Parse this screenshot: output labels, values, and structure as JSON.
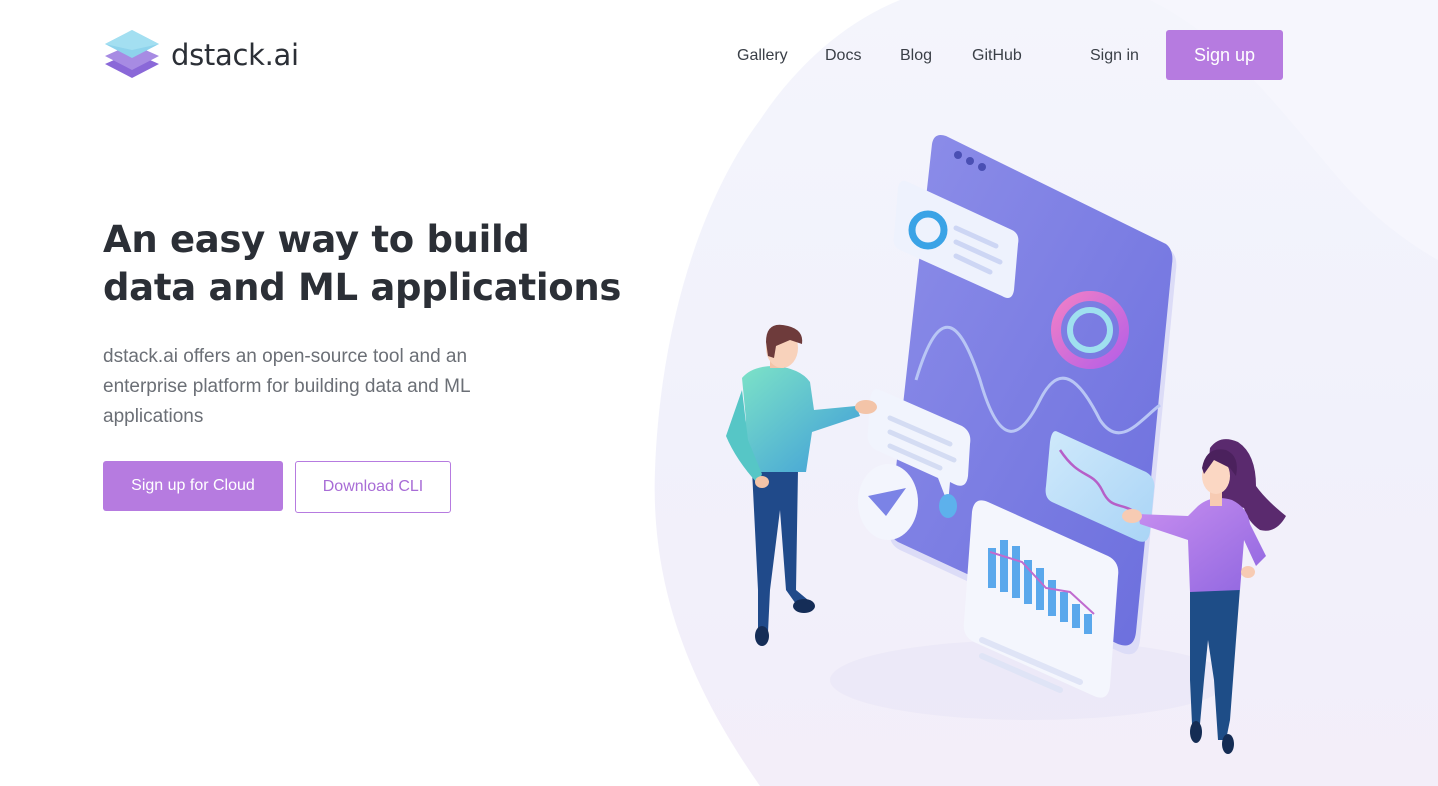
{
  "header": {
    "logo_text": "dstack.ai",
    "nav": {
      "gallery": "Gallery",
      "docs": "Docs",
      "blog": "Blog",
      "github": "GitHub",
      "sign_in": "Sign in",
      "sign_up": "Sign up"
    }
  },
  "hero": {
    "title": "An easy way to build data and ML applications",
    "description": "dstack.ai offers an open-source tool and an enterprise platform for building data and ML applications",
    "cta_primary": "Sign up for Cloud",
    "cta_secondary": "Download CLI"
  },
  "colors": {
    "accent": "#b67be0",
    "heading": "#2b2f36",
    "body_text": "#6b6f76",
    "illustration_phone": "#7f7fe6"
  },
  "icons": {
    "logo": "stacked-layers-icon"
  }
}
